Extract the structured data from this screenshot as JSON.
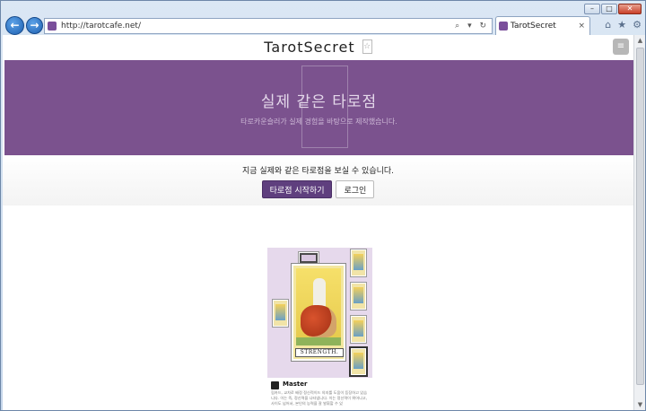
{
  "browser": {
    "url": "http://tarotcafe.net/",
    "tab_title": "TarotSecret",
    "tab_close": "×",
    "titlebar": {
      "minimize": "–",
      "maximize": "□",
      "close": "✕"
    },
    "nav": {
      "back": "←",
      "forward": "→"
    },
    "address_icons": "⌕ ▾ ↻",
    "tools": {
      "home": "⌂",
      "favorites": "★",
      "settings": "⚙"
    }
  },
  "site": {
    "brand": "TarotSecret",
    "star": "☆",
    "menu": "≡"
  },
  "hero": {
    "title": "실제 같은 타로점",
    "subtitle": "타로카운슬러가 실제 경험을 바탕으로 제작했습니다."
  },
  "cta": {
    "text": "지금 실제와 같은 타로점을 보실 수 있습니다.",
    "start_button": "타로점 시작하기",
    "login_button": "로그인"
  },
  "preview": {
    "card_label": "STRENGTH.",
    "author": "Master",
    "caption": "힘카드, 교차로 배정 정신적이드 의지를 도움이 등장하고 있습니다. 이는 즉, 정신력을 나타냅니다. 이는 정신력이 뛰어나고, 사이도 넘어서, 본인의 능력을 잘 발휘할 수 있"
  },
  "scrollbar": {
    "up": "▲",
    "down": "▼"
  }
}
